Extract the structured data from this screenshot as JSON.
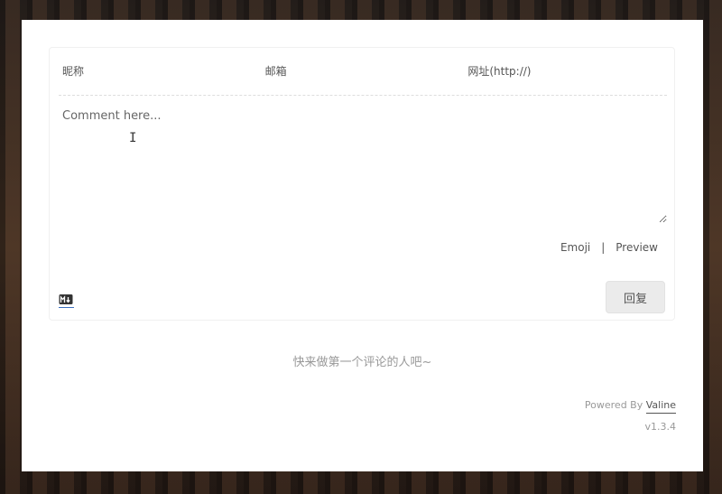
{
  "form": {
    "nickname_placeholder": "昵称",
    "email_placeholder": "邮箱",
    "website_placeholder": "网址(http://)",
    "comment_placeholder": "Comment here..."
  },
  "tools": {
    "emoji_label": "Emoji",
    "separator": "|",
    "preview_label": "Preview"
  },
  "markdown_icon": "markdown-icon",
  "reply_button": "回复",
  "empty_message": "快来做第一个评论的人吧~",
  "footer": {
    "powered_by": "Powered By ",
    "brand": "Valine",
    "version": "v1.3.4"
  },
  "colors": {
    "panel_bg": "#ffffff",
    "button_bg": "#ebebeb",
    "accent_underline": "#3a6fbf"
  }
}
